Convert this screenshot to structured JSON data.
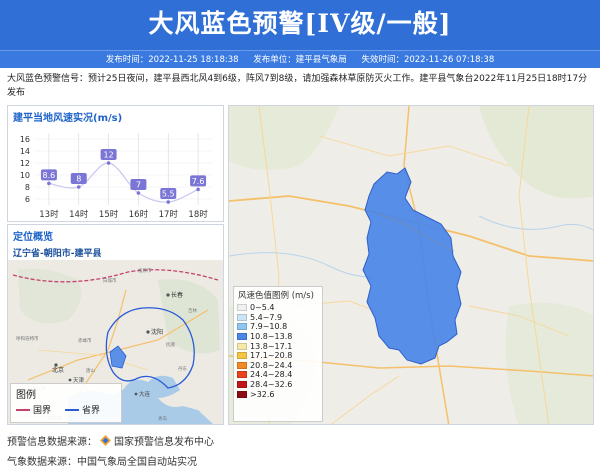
{
  "header": {
    "title": "大风蓝色预警[IV级/一般]",
    "publish_time": "发布时间：2022-11-25 18:18:38",
    "publisher": "发布单位：建平县气象局",
    "expire_time": "失效时间：2022-11-26 07:18:38"
  },
  "description": "大风蓝色预警信号：预计25日夜间，建平县西北风4到6级，阵风7到8级，请加强森林草原防灭火工作。建平县气象台2022年11月25日18时17分发布",
  "wind_panel": {
    "title": "建平当地风速实况(m/s)"
  },
  "chart_data": {
    "type": "line",
    "categories": [
      "13时",
      "14时",
      "15时",
      "16时",
      "17时",
      "18时"
    ],
    "values": [
      8.6,
      8,
      12,
      7,
      5.5,
      7.6
    ],
    "yticks": [
      "16",
      "14",
      "12",
      "10",
      "8",
      "6"
    ],
    "ylim": [
      5,
      17
    ],
    "color": "#7b75d6"
  },
  "location": {
    "title": "定位概览",
    "name": "辽宁省-朝阳市-建平县",
    "cities": [
      "长春",
      "沈阳",
      "北京",
      "天津",
      "大连"
    ],
    "places": [
      "松原市",
      "白城市",
      "吉林",
      "呼和浩特市",
      "赤峰市",
      "抚顺",
      "丹东",
      "石家庄市",
      "济南市",
      "青岛",
      "唐山"
    ],
    "legend_title": "图例",
    "legend_national": "国界",
    "legend_province": "省界",
    "national_color": "#c6406c",
    "province_color": "#2a5bd7"
  },
  "map": {
    "legend_title": "风速色值图例 (m/s)",
    "legend": [
      {
        "label": "0~5.4",
        "color": "#f1f1f1"
      },
      {
        "label": "5.4~7.9",
        "color": "#cde4f7"
      },
      {
        "label": "7.9~10.8",
        "color": "#8fc6f0"
      },
      {
        "label": "10.8~13.8",
        "color": "#4a86e8"
      },
      {
        "label": "13.8~17.1",
        "color": "#f6e9a8"
      },
      {
        "label": "17.1~20.8",
        "color": "#f5c542"
      },
      {
        "label": "20.8~24.4",
        "color": "#f08a24"
      },
      {
        "label": "24.4~28.4",
        "color": "#e8431c"
      },
      {
        "label": "28.4~32.6",
        "color": "#c0161a"
      },
      {
        "label": ">32.6",
        "color": "#8a0c14"
      }
    ],
    "region_color": "#4a86e8"
  },
  "footer": {
    "warning_source_label": "预警信息数据来源：",
    "warning_source": "国家预警信息发布中心",
    "weather_source_label": "气象数据来源：",
    "weather_source": "中国气象局全国自动站实况"
  }
}
